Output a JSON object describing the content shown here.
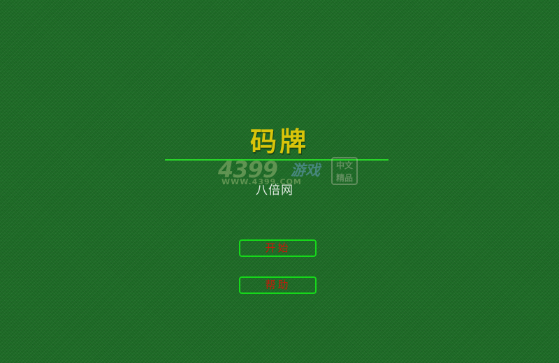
{
  "game": {
    "title": "码牌",
    "subtitle": "八倍网"
  },
  "watermark": {
    "logo_text": "4399",
    "game_text": "游戏",
    "url_text": "WWW.4399.COM",
    "seal_text": "中文精品"
  },
  "menu": {
    "start_label": "开始",
    "help_label": "帮助"
  },
  "colors": {
    "felt_green": "#1f6e28",
    "title_yellow": "#d8c40a",
    "divider_green": "#29d629",
    "button_border_green": "#16d81a",
    "button_text_red": "#c81a0a"
  }
}
